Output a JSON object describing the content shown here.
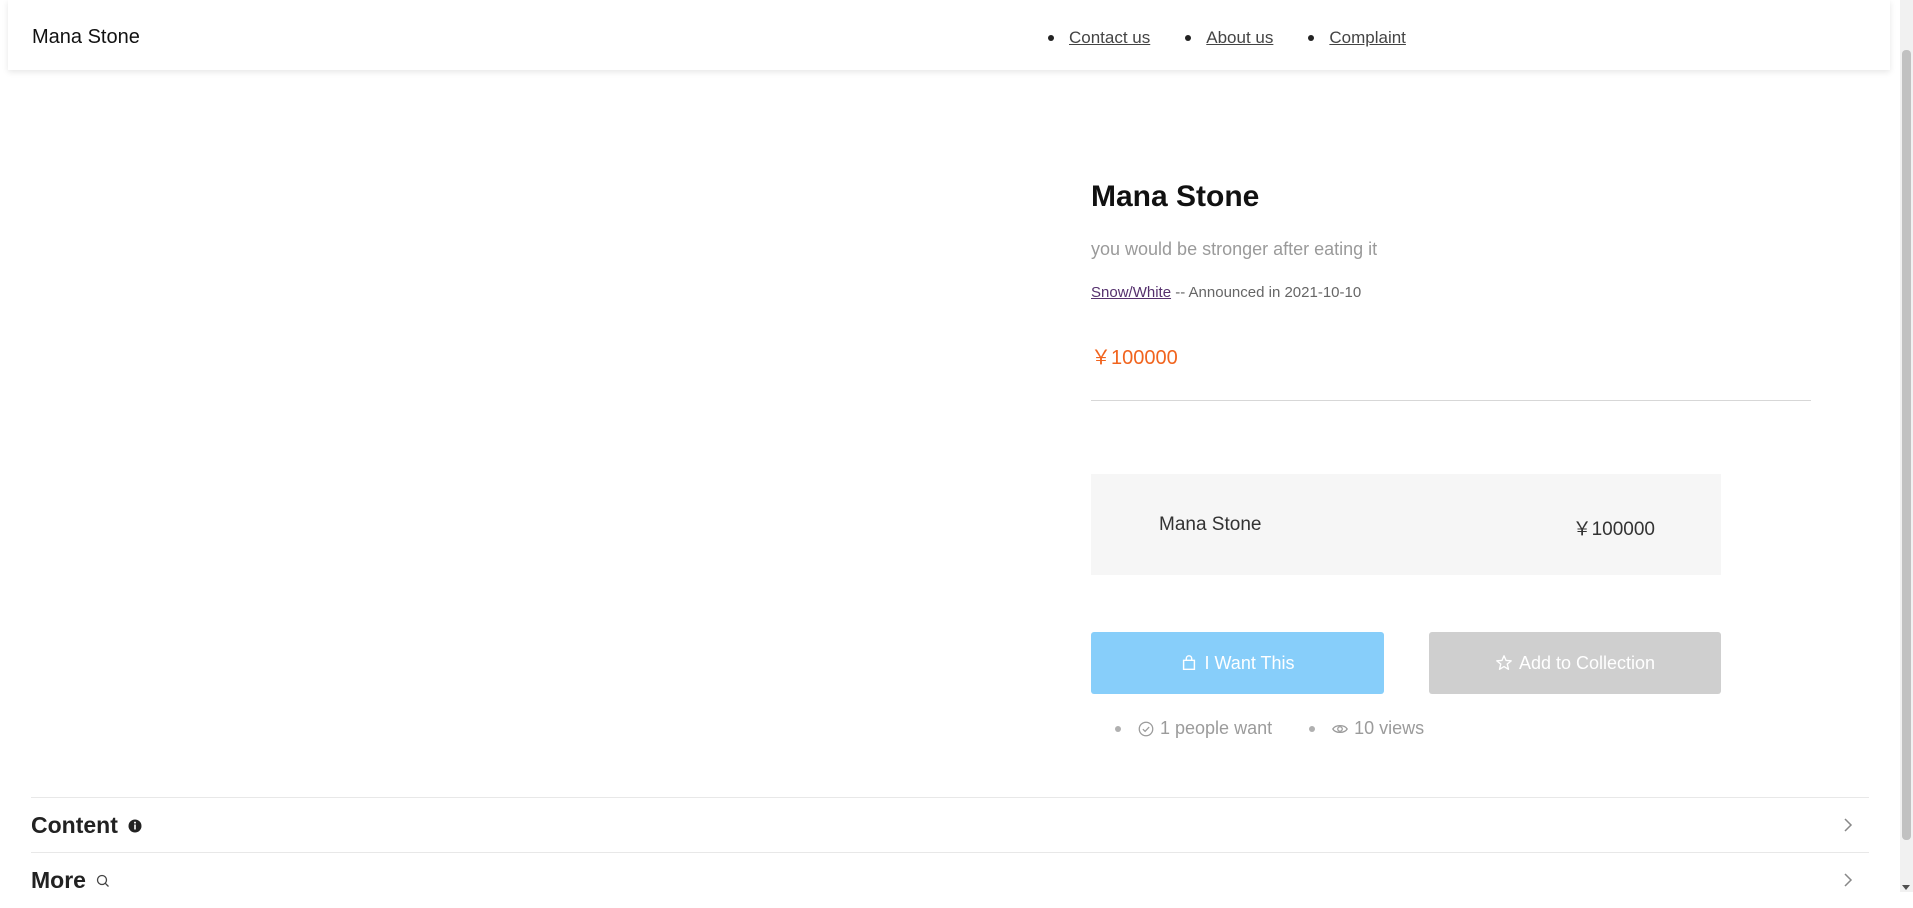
{
  "header": {
    "brand": "Mana Stone",
    "nav": [
      {
        "label": "Contact us"
      },
      {
        "label": "About us"
      },
      {
        "label": "Complaint"
      }
    ]
  },
  "product": {
    "title": "Mana Stone",
    "subtitle": "you would be stronger after eating it",
    "seller": "Snow/White",
    "announced_text": " -- Announced in 2021-10-10",
    "price": "￥100000"
  },
  "option": {
    "name": "Mana Stone",
    "price": "￥100000"
  },
  "actions": {
    "want_label": "I Want This",
    "want_icon": "shopping-bag-icon",
    "collect_label": "Add to Collection",
    "collect_icon": "star-icon"
  },
  "stats": {
    "want_count": "1 people want",
    "views": "10 views"
  },
  "sections": {
    "content": "Content",
    "more": "More"
  },
  "colors": {
    "price": "#f1641e",
    "primary_button": "#87cefa",
    "secondary_button": "#cfcfcf"
  }
}
